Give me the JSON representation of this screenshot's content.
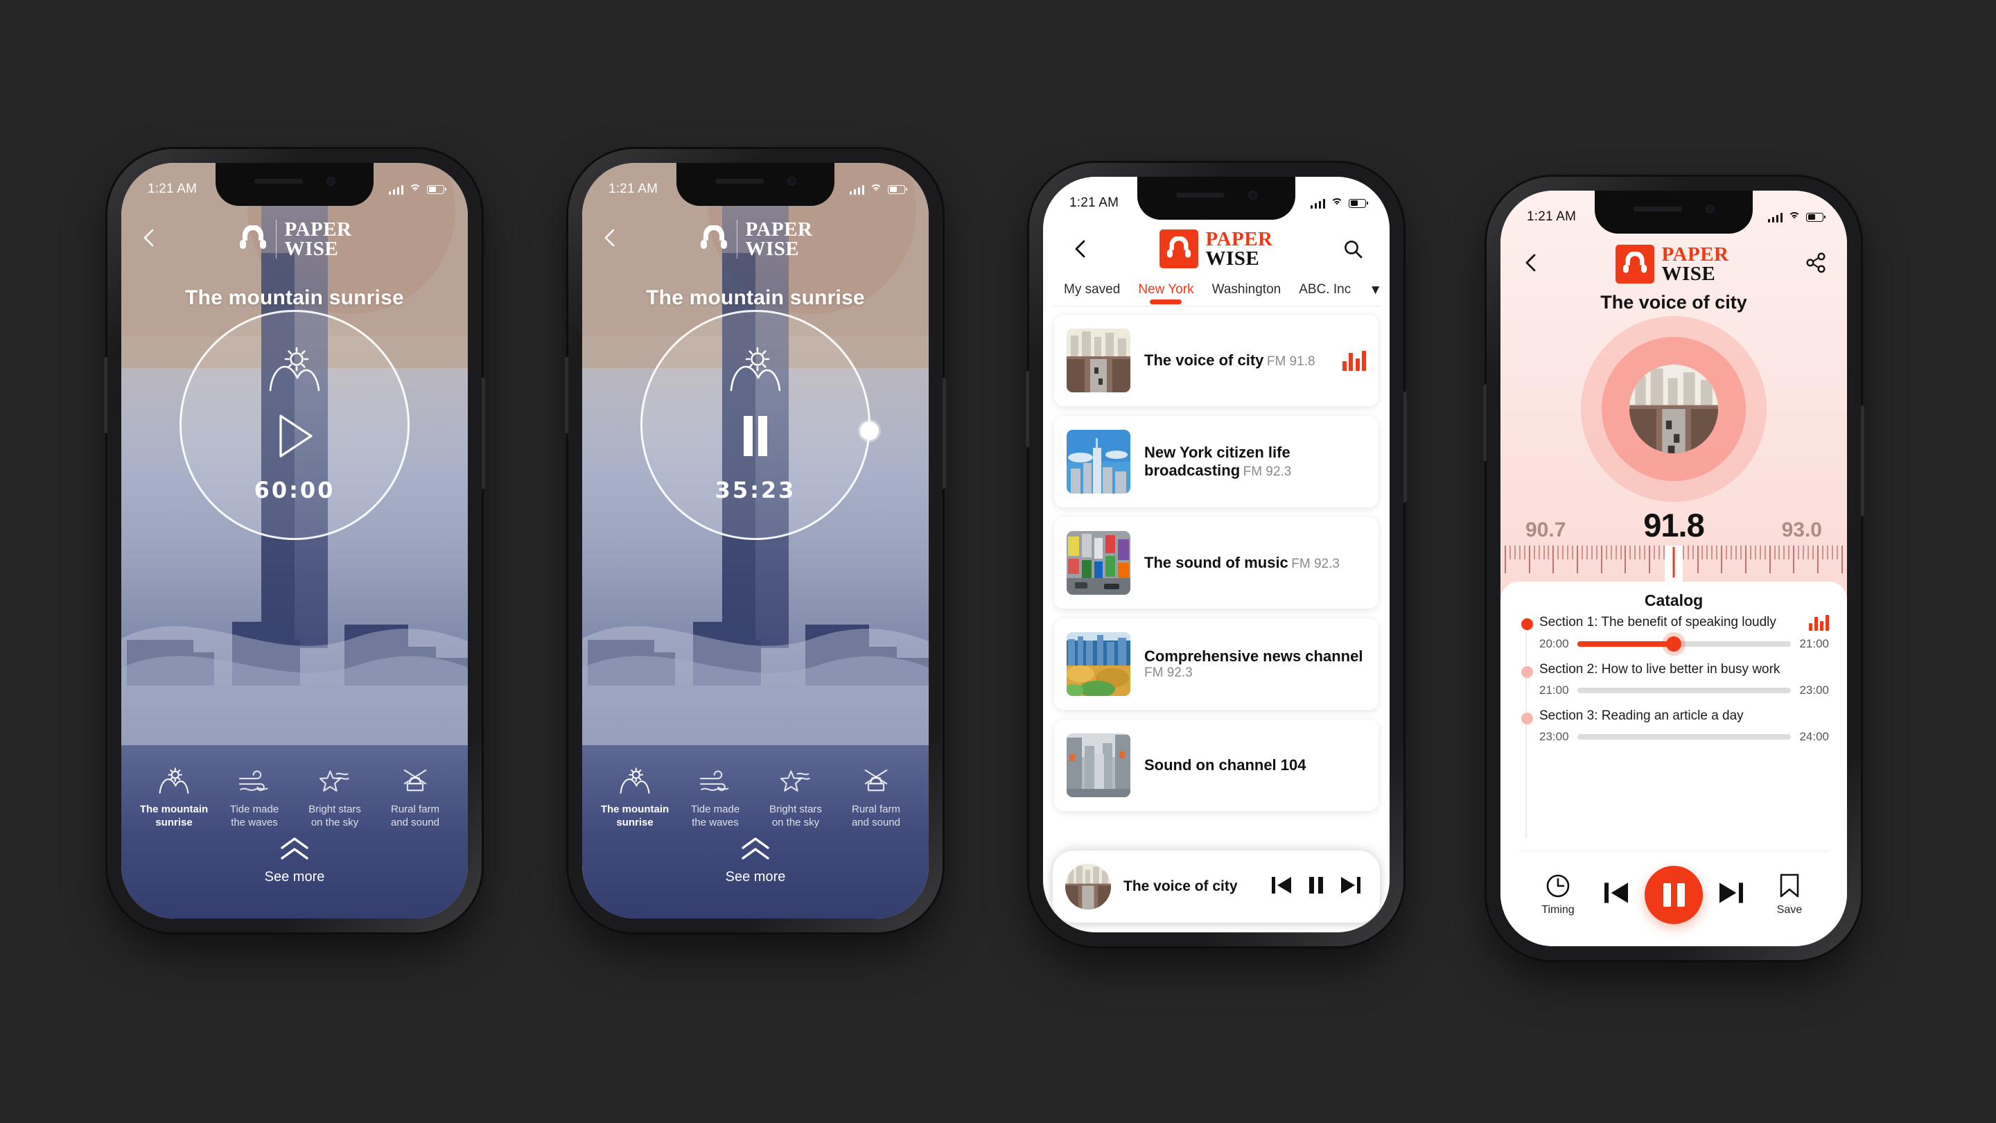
{
  "brand": {
    "line1": "PAPER",
    "line2": "WISE"
  },
  "status": {
    "time": "1:21 AM",
    "signal_icon": "signal-bars-icon",
    "wifi_icon": "wifi-icon",
    "battery_icon": "battery-icon"
  },
  "phone1": {
    "title": "The mountain sunrise",
    "time_display": "60:00",
    "play_state": "play",
    "back_icon": "back-chevron-icon",
    "center_icon": "mountain-sunrise-icon",
    "modes": [
      {
        "label_line1": "The mountain",
        "label_line2": "sunrise",
        "icon": "mountain-sunrise-icon",
        "active": true
      },
      {
        "label_line1": "Tide made",
        "label_line2": "the waves",
        "icon": "waves-icon",
        "active": false
      },
      {
        "label_line1": "Bright stars",
        "label_line2": "on the sky",
        "icon": "star-icon",
        "active": false
      },
      {
        "label_line1": "Rural farm",
        "label_line2": "and sound",
        "icon": "windmill-icon",
        "active": false
      }
    ],
    "see_more": "See more",
    "see_more_icon": "double-chevron-up-icon"
  },
  "phone2": {
    "title": "The mountain sunrise",
    "time_display": "35:23",
    "play_state": "pause",
    "progress_percent": 41,
    "back_icon": "back-chevron-icon",
    "center_icon": "mountain-sunrise-icon",
    "modes": [
      {
        "label_line1": "The mountain",
        "label_line2": "sunrise",
        "icon": "mountain-sunrise-icon",
        "active": true
      },
      {
        "label_line1": "Tide made",
        "label_line2": "the waves",
        "icon": "waves-icon",
        "active": false
      },
      {
        "label_line1": "Bright stars",
        "label_line2": "on the sky",
        "icon": "star-icon",
        "active": false
      },
      {
        "label_line1": "Rural farm",
        "label_line2": "and sound",
        "icon": "windmill-icon",
        "active": false
      }
    ],
    "see_more": "See more",
    "see_more_icon": "double-chevron-up-icon"
  },
  "phone3": {
    "back_icon": "back-chevron-icon",
    "search_icon": "search-icon",
    "caret_icon": "chevron-down-icon",
    "tabs": [
      {
        "label": "My saved",
        "active": false
      },
      {
        "label": "New York",
        "active": true
      },
      {
        "label": "Washington",
        "active": false
      },
      {
        "label": "ABC. Inc",
        "active": false
      }
    ],
    "stations": [
      {
        "name": "The voice of city",
        "freq": "FM 91.8",
        "playing": true,
        "thumb": "city-street-skyline"
      },
      {
        "name": "New York citizen life broadcasting",
        "freq": "FM 92.3",
        "playing": false,
        "thumb": "downtown-towers-blue-sky"
      },
      {
        "name": "The sound of music",
        "freq": "FM 92.3",
        "playing": false,
        "thumb": "times-square-billboards"
      },
      {
        "name": "Comprehensive news channel",
        "freq": "FM 92.3",
        "playing": false,
        "thumb": "central-park-aerial"
      },
      {
        "name": "Sound on channel 104",
        "freq": "",
        "playing": false,
        "thumb": "manhattan-avenue"
      }
    ],
    "miniplayer": {
      "title": "The voice of city",
      "prev_icon": "skip-previous-icon",
      "pause_icon": "pause-icon",
      "next_icon": "skip-next-icon"
    }
  },
  "phone4": {
    "back_icon": "back-chevron-icon",
    "share_icon": "share-icon",
    "title": "The voice of city",
    "album_art": "city-street-skyline",
    "tuner": {
      "left_freq": "90.7",
      "current_freq": "91.8",
      "right_freq": "93.0"
    },
    "catalog_heading": "Catalog",
    "sections": [
      {
        "title": "Section 1: The benefit of speaking loudly",
        "start": "20:00",
        "end": "21:00",
        "progress_percent": 45,
        "active": true
      },
      {
        "title": "Section 2: How to live better in busy work",
        "start": "21:00",
        "end": "23:00",
        "progress_percent": 0,
        "active": false
      },
      {
        "title": "Section 3: Reading an article a day",
        "start": "23:00",
        "end": "24:00",
        "progress_percent": 0,
        "active": false
      }
    ],
    "controls": {
      "timing_label": "Timing",
      "timing_icon": "clock-icon",
      "prev_icon": "skip-previous-icon",
      "play_icon": "pause-icon",
      "next_icon": "skip-next-icon",
      "save_label": "Save",
      "save_icon": "bookmark-icon"
    }
  },
  "colors": {
    "accent": "#F03A17",
    "night": "#333E6E",
    "dawn": "#B9A396",
    "blush": "#F9A096"
  }
}
